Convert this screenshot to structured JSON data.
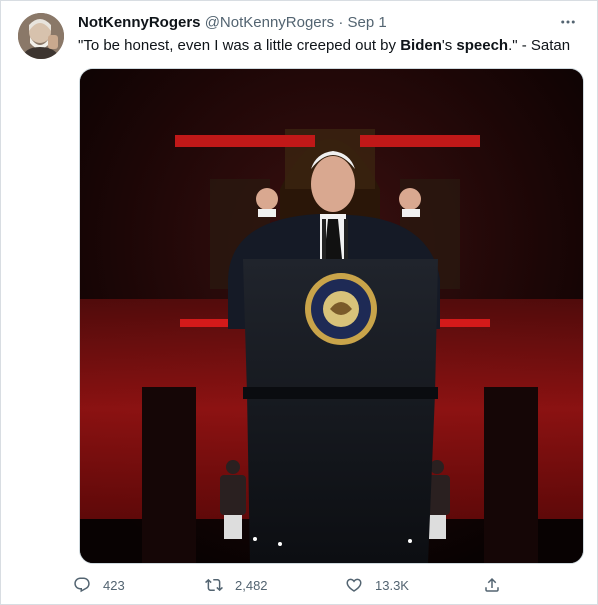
{
  "tweet": {
    "display_name": "NotKennyRogers",
    "handle": "@NotKennyRogers",
    "separator": "·",
    "date": "Sep 1",
    "text_part1": "\"To be honest, even I was a little creeped out by ",
    "text_bold1": "Biden",
    "text_part2": "'s ",
    "text_bold2": "speech",
    "text_part3": ".\" - Satan"
  },
  "media": {
    "seal_text": "PRESIDENT OF THE UNITED STATES",
    "dominant_colors": [
      "#0c0404",
      "#b01818",
      "#1a1d24"
    ]
  },
  "actions": {
    "replies": "423",
    "retweets": "2,482",
    "likes": "13.3K"
  },
  "icons": [
    "more-icon",
    "reply-icon",
    "retweet-icon",
    "like-icon",
    "share-icon"
  ]
}
